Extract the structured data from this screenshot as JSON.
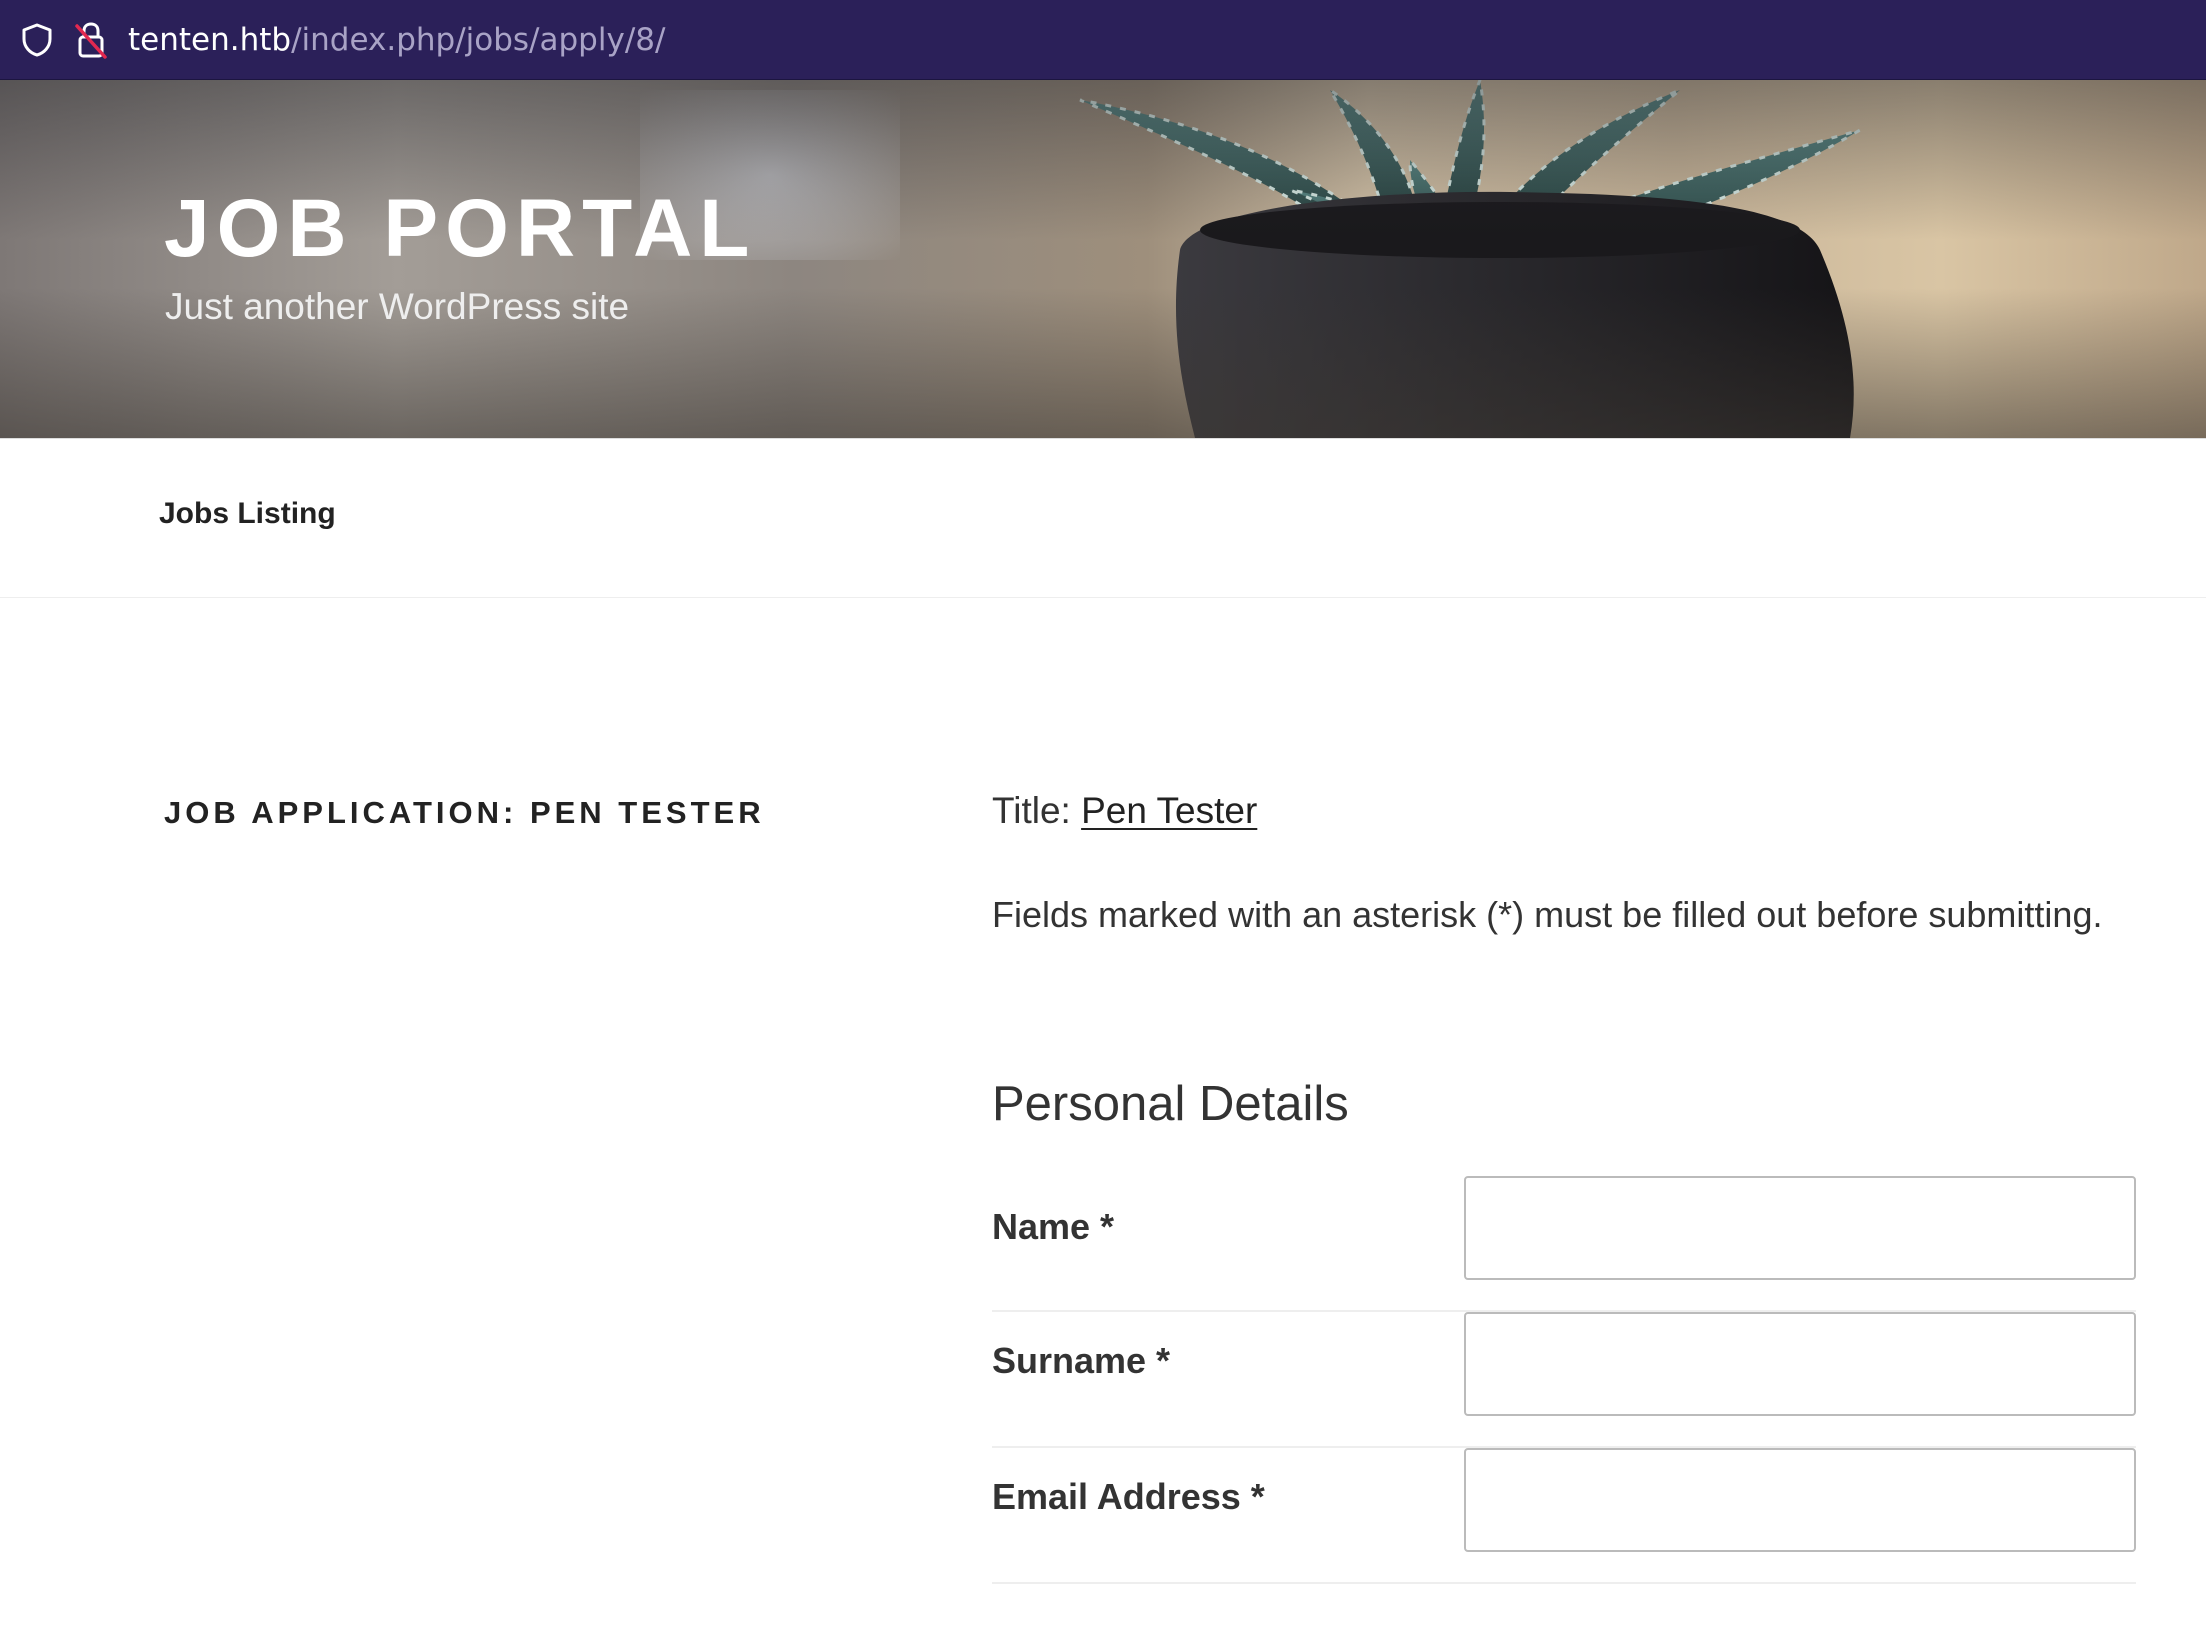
{
  "browser": {
    "url_host": "tenten.htb",
    "url_path": "/index.php/jobs/apply/8/",
    "icons": [
      "shield-icon",
      "lock-insecure-icon"
    ],
    "bar_color": "#2b2059"
  },
  "site": {
    "title": "JOB PORTAL",
    "description": "Just another WordPress site"
  },
  "nav": {
    "items": [
      {
        "label": "Jobs Listing"
      }
    ]
  },
  "page": {
    "heading": "JOB APPLICATION: PEN TESTER",
    "title_prefix": "Title: ",
    "job_link": "Pen Tester",
    "required_note": "Fields marked with an asterisk (*) must be filled out before submitting.",
    "section_title": "Personal Details",
    "fields": [
      {
        "label": "Name *",
        "value": ""
      },
      {
        "label": "Surname *",
        "value": ""
      },
      {
        "label": "Email Address *",
        "value": ""
      }
    ]
  }
}
